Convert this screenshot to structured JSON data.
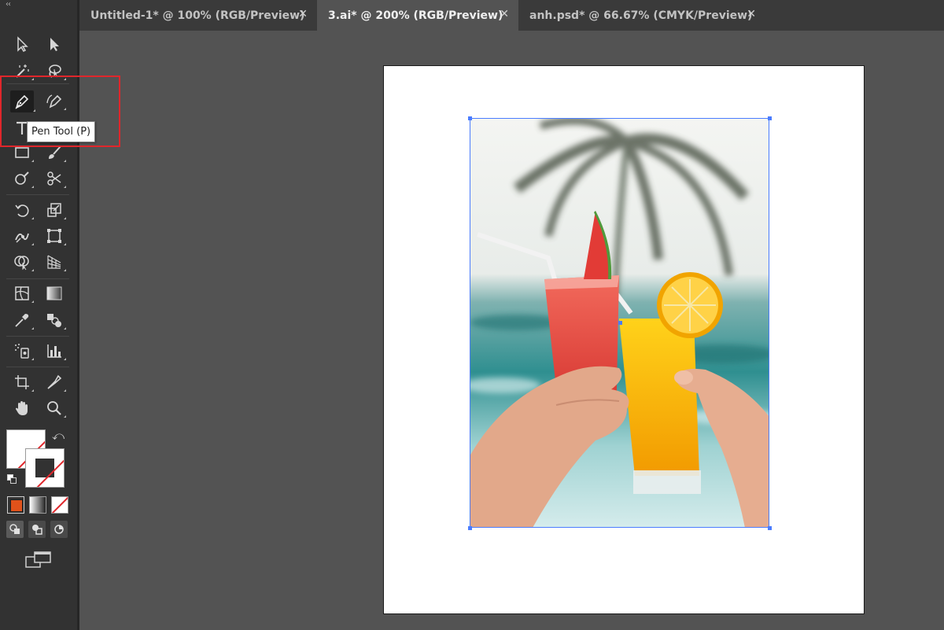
{
  "tabs": [
    {
      "label": "Untitled-1* @ 100% (RGB/Preview)",
      "close": "✕"
    },
    {
      "label": "3.ai* @ 200% (RGB/Preview)",
      "close": "✕"
    },
    {
      "label": "anh.psd* @ 66.67% (CMYK/Preview)",
      "close": "✕"
    }
  ],
  "toolbar": {
    "collapse_glyph": "‹‹",
    "tooltip": "Pen Tool (P)",
    "swap_glyph": "⤺",
    "tools": [
      "selection-tool",
      "direct-selection-tool",
      "magic-wand-tool",
      "lasso-tool",
      "pen-tool",
      "curvature-tool",
      "type-tool",
      "line-segment-tool",
      "rectangle-tool",
      "paintbrush-tool",
      "shaper-tool",
      "scissors-tool",
      "rotate-tool",
      "scale-tool",
      "puppet-warp-tool",
      "free-transform-tool",
      "shape-builder-tool",
      "perspective-grid-tool",
      "mesh-tool",
      "gradient-tool",
      "eyedropper-tool",
      "blend-tool",
      "symbol-sprayer-tool",
      "column-graph-tool",
      "artboard-tool",
      "slice-tool",
      "hand-tool",
      "zoom-tool"
    ]
  },
  "colors": {
    "fill": "none",
    "stroke": "none",
    "highlight": "#e0262b",
    "selection": "#4a7cff"
  }
}
